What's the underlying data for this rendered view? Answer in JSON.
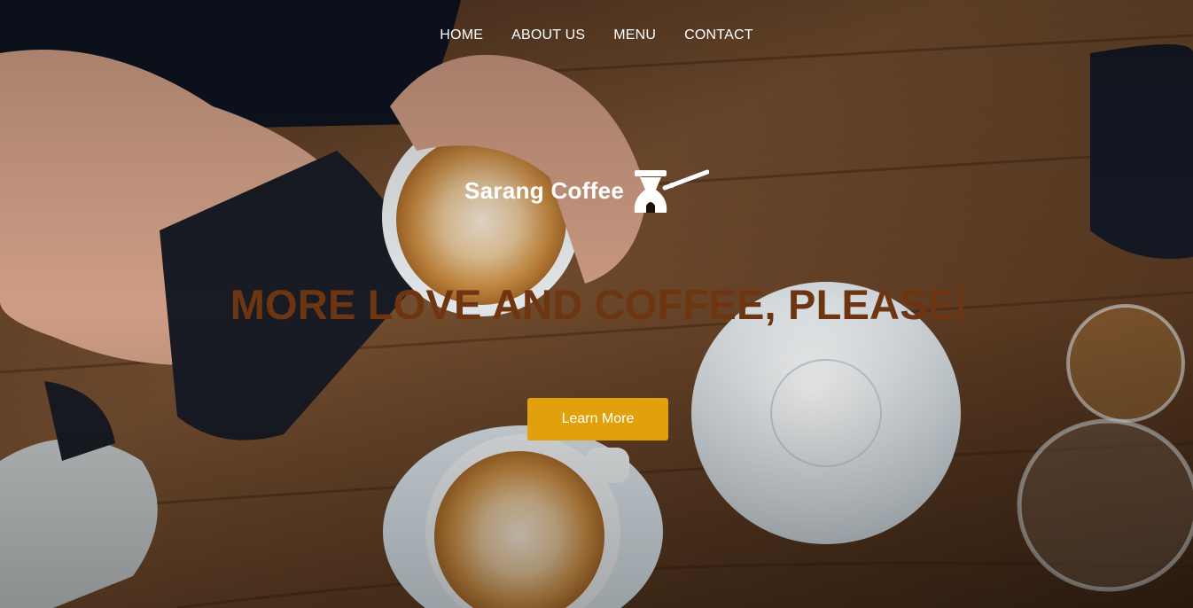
{
  "nav": {
    "items": [
      {
        "label": "HOME"
      },
      {
        "label": "ABOUT US"
      },
      {
        "label": "MENU"
      },
      {
        "label": "CONTACT"
      }
    ]
  },
  "brand": {
    "name": "Sarang Coffee",
    "icon": "coffee-pot-icon"
  },
  "hero": {
    "headline": "MORE LOVE AND COFFEE, PLEASE",
    "cta_label": "Learn More",
    "background": "cafe-table-latte-art-photo"
  },
  "colors": {
    "headline": "#6e3511",
    "cta": "#e0a10c",
    "nav_text": "#ffffff"
  }
}
